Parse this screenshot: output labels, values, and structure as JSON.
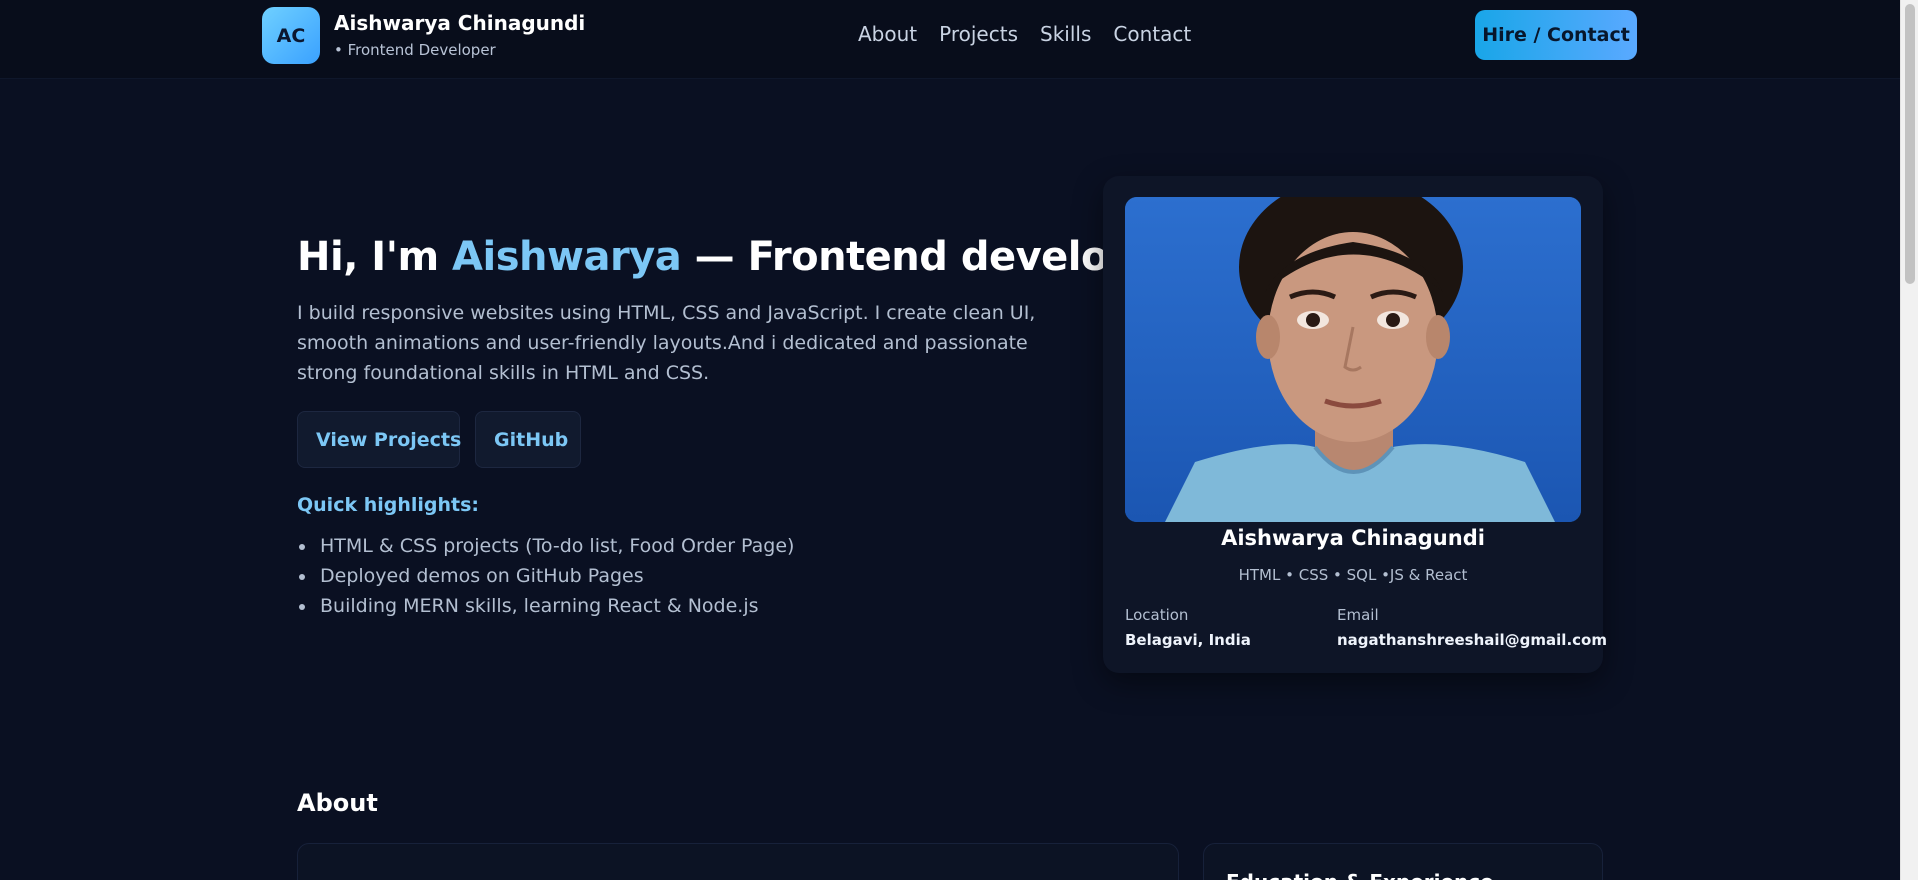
{
  "header": {
    "logo_initials": "AC",
    "brand_name": "Aishwarya Chinagundi",
    "brand_subtitle": "• Frontend Developer",
    "nav": [
      "About",
      "Projects",
      "Skills",
      "Contact"
    ],
    "cta_label": "Hire / Contact"
  },
  "hero": {
    "title_prefix": "Hi, I'm ",
    "title_accent": "Aishwarya",
    "title_suffix": " — Frontend developer",
    "description": "I build responsive websites using HTML, CSS and JavaScript. I create clean UI, smooth animations and user-friendly layouts.And i dedicated and passionate strong foundational skills in HTML and CSS.",
    "buttons": {
      "projects": "View Projects",
      "github": "GitHub"
    },
    "highlights_title": "Quick highlights:",
    "highlights": [
      "HTML & CSS projects (To-do list, Food Order Page)",
      "Deployed demos on GitHub Pages",
      "Building MERN skills, learning React & Node.js"
    ]
  },
  "profile_card": {
    "name": "Aishwarya Chinagundi",
    "skills": "HTML • CSS • SQL •JS & React",
    "location_label": "Location",
    "location_value": "Belagavi, India",
    "email_label": "Email",
    "email_value": "nagathanshreeshail@gmail.com"
  },
  "about": {
    "title": "About",
    "education_title": "Education & Experience"
  },
  "colors": {
    "background": "#0a1022",
    "accent": "#7cc7f5",
    "cta": "#19a6e8"
  }
}
